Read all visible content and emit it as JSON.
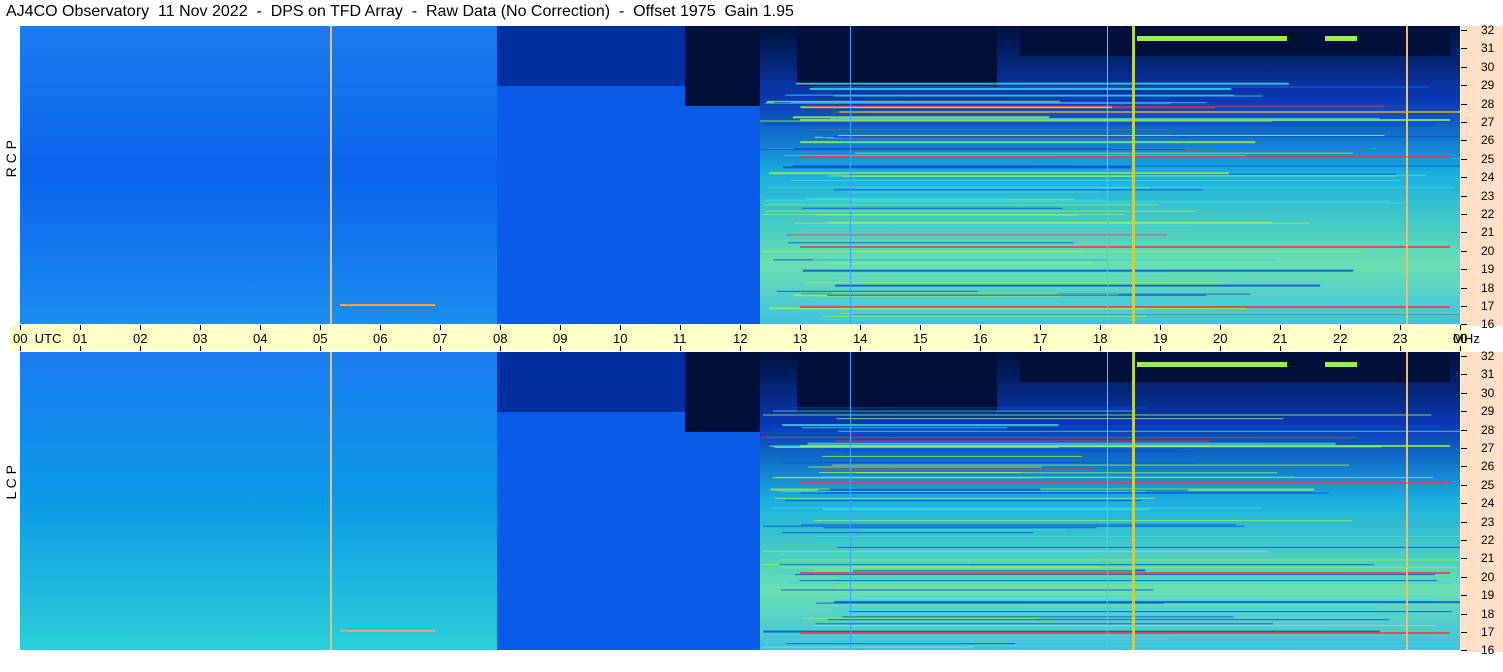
{
  "header": {
    "title": "AJ4CO Observatory  11 Nov 2022  -  DPS on TFD Array  -  Raw Data (No Correction)  -  Offset 1975  Gain 1.95"
  },
  "panels": [
    {
      "id": "rcp",
      "label": "R C P"
    },
    {
      "id": "lcp",
      "label": "L C P"
    }
  ],
  "time_axis": {
    "labels": [
      "00  UTC",
      "01",
      "02",
      "03",
      "04",
      "05",
      "06",
      "07",
      "08",
      "09",
      "10",
      "11",
      "12",
      "13",
      "14",
      "15",
      "16",
      "17",
      "18",
      "19",
      "20",
      "21",
      "22",
      "23",
      "00"
    ],
    "unit": "MHz"
  },
  "freq_axis": {
    "labels": [
      "32",
      "31",
      "30",
      "29",
      "28",
      "27",
      "26",
      "25",
      "24",
      "23",
      "22",
      "21",
      "20",
      "19",
      "18",
      "17",
      "16"
    ]
  },
  "colors": {
    "quiet": "#0a5ce8",
    "night": "#00103a",
    "hot": "#9cf04a",
    "rfi": "#ff3040",
    "axis_time_bg": "#ffffc8",
    "axis_freq_bg": "#ffdfc6"
  }
}
